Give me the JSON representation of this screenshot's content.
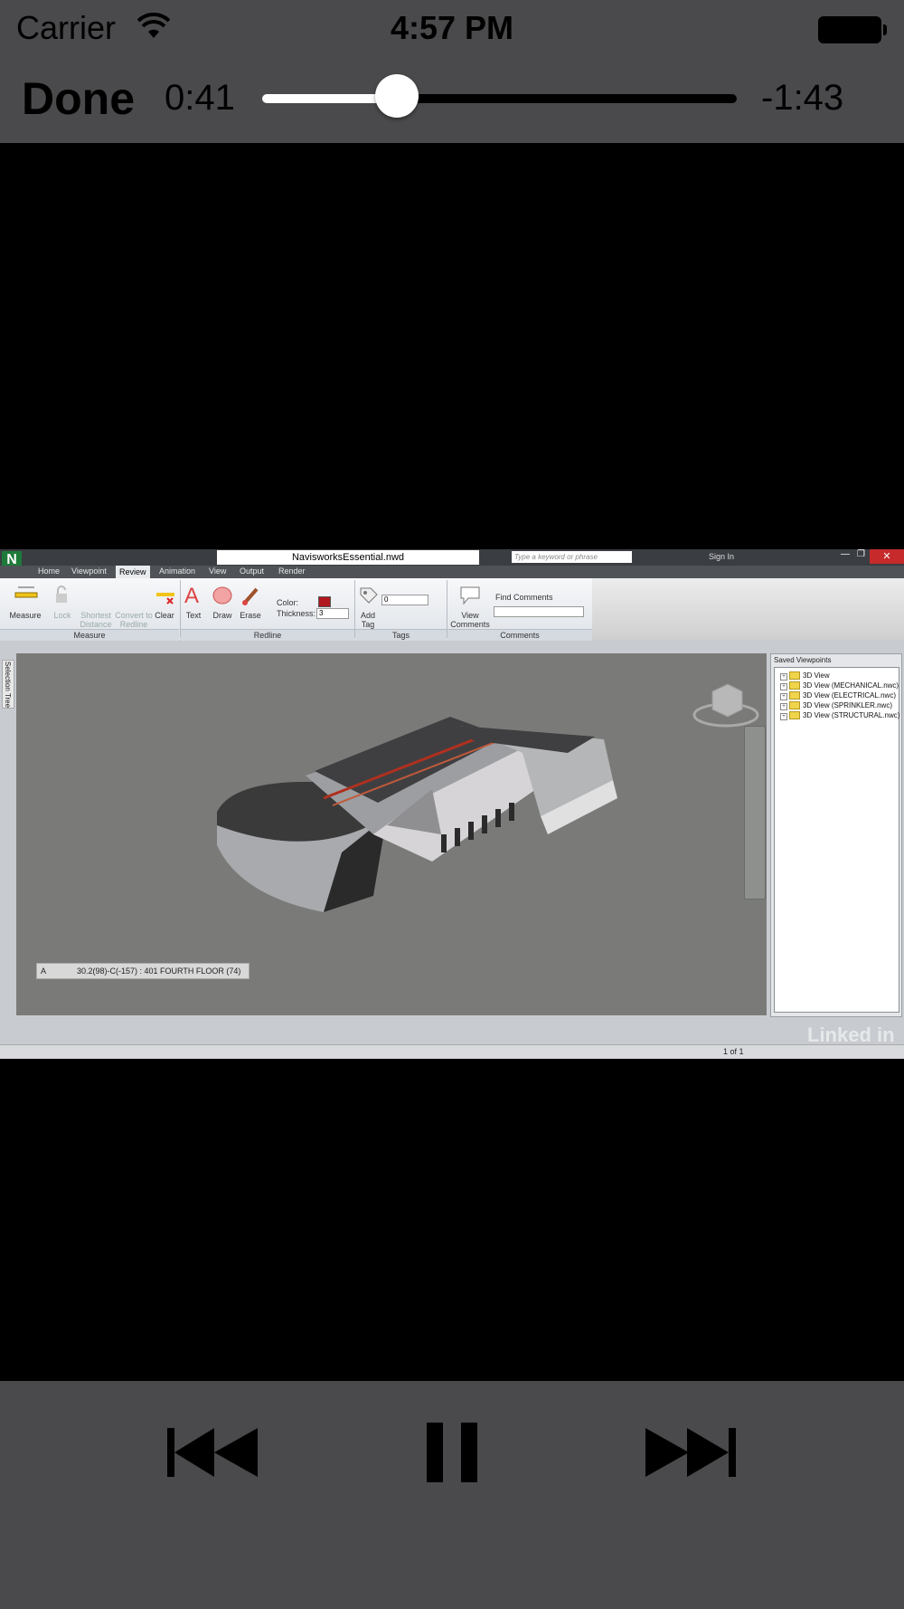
{
  "status_bar": {
    "carrier": "Carrier",
    "time": "4:57 PM"
  },
  "player": {
    "done_label": "Done",
    "elapsed": "0:41",
    "remaining": "-1:43",
    "progress": 0.284
  },
  "video": {
    "app": {
      "logo": "N",
      "filename": "NavisworksEssential.nwd",
      "search_placeholder": "Type a keyword or phrase",
      "sign_in": "Sign In",
      "tabs": [
        "Home",
        "Viewpoint",
        "Review",
        "Animation",
        "View",
        "Output",
        "Render"
      ],
      "active_tab": "Review",
      "ribbon": {
        "measure": "Measure",
        "lock": "Lock",
        "shortest_distance": "Shortest Distance",
        "convert_to_redline": "Convert to Redline",
        "clear": "Clear",
        "text": "Text",
        "draw": "Draw",
        "erase": "Erase",
        "color_label": "Color:",
        "thickness_label": "Thickness:",
        "thickness_value": "3",
        "tag_value": "0",
        "add_tag": "Add Tag",
        "view_comments": "View Comments",
        "find_comments": "Find Comments",
        "panels": [
          "Measure",
          "Redline",
          "Tags",
          "Comments"
        ]
      },
      "selection_tree_tab": "Selection Tree",
      "hud_label": "A",
      "hud_text": "30.2(98)-C(-157) : 401 FOURTH FLOOR (74)",
      "saved_viewpoints": {
        "title": "Saved Viewpoints",
        "items": [
          "3D View",
          "3D View (MECHANICAL.nwc)",
          "3D View (ELECTRICAL.nwc)",
          "3D View (SPRINKLER.nwc)",
          "3D View (STRUCTURAL.nwc)"
        ]
      },
      "page_indicator": "1 of 1",
      "watermark": "Linked in"
    }
  },
  "colors": {
    "chrome": "#4a4a4c",
    "accent_white": "#ffffff",
    "redline_color": "#b0171f"
  },
  "icons": [
    "wifi-icon",
    "battery-icon",
    "rewind-icon",
    "pause-icon",
    "fast-forward-icon"
  ]
}
